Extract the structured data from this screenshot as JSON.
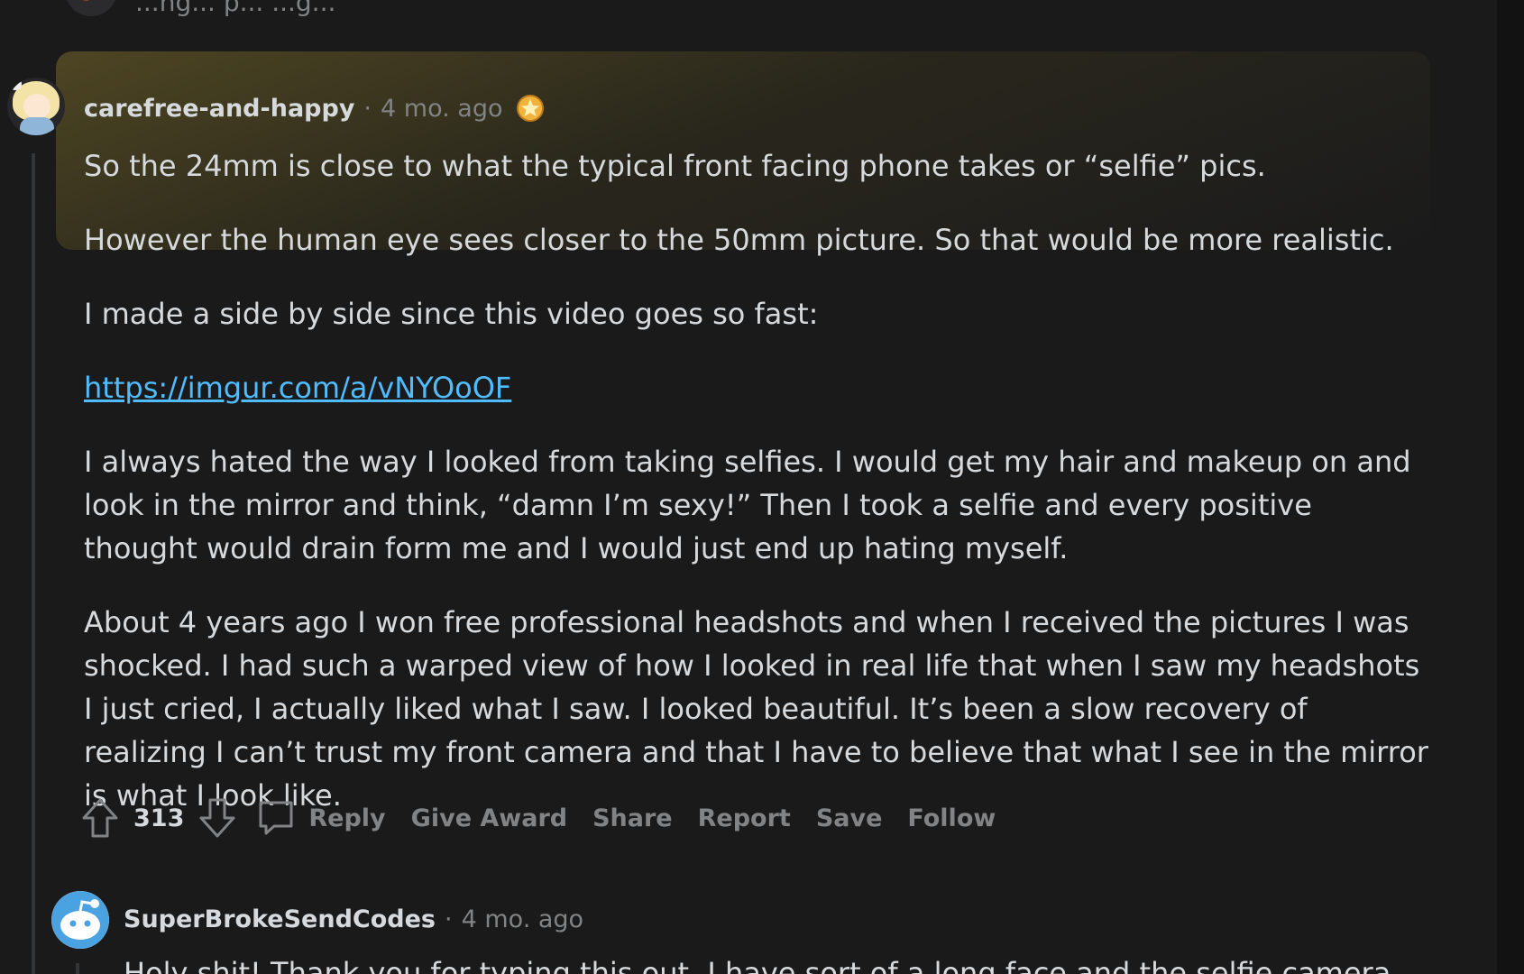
{
  "previous_comment": {
    "snippet": "...ng... p... ...g..."
  },
  "comment": {
    "author": "carefree-and-happy",
    "separator": "·",
    "time": "4 mo. ago",
    "award_icon": "star-award-icon",
    "paragraphs": [
      "So the 24mm is close to what the typical front facing phone takes or “selfie” pics.",
      "However the human eye sees closer to the 50mm picture. So that would be more realistic.",
      "I made a side by side since this video goes so fast:",
      "I always hated the way I looked from taking selfies. I would get my hair and makeup on and look in the mirror and think, “damn I’m sexy!” Then I took a selfie and every positive thought would drain form me and I would just end up hating myself.",
      "About 4 years ago I won free professional headshots and when I received the pictures I was shocked. I had such a warped view of how I looked in real life that when I saw my headshots I just cried, I actually liked what I saw. I looked beautiful. It’s been a slow recovery of realizing I can’t trust my front camera and that I have to believe that what I see in the mirror is what I look like."
    ],
    "link": "https://imgur.com/a/vNYOoOF",
    "votes": "313",
    "actions": {
      "reply": "Reply",
      "give_award": "Give Award",
      "share": "Share",
      "report": "Report",
      "save": "Save",
      "follow": "Follow"
    }
  },
  "reply_comment": {
    "author": "SuperBrokeSendCodes",
    "separator": "·",
    "time": "4 mo. ago",
    "body_partial": "Holy shit! Thank you for typing this out. I have sort of a long face and the selfie camera"
  },
  "colors": {
    "background": "#1a1a1b",
    "text": "#d7dadc",
    "meta": "#818384",
    "link": "#4fbcff",
    "highlight": "#786928"
  }
}
